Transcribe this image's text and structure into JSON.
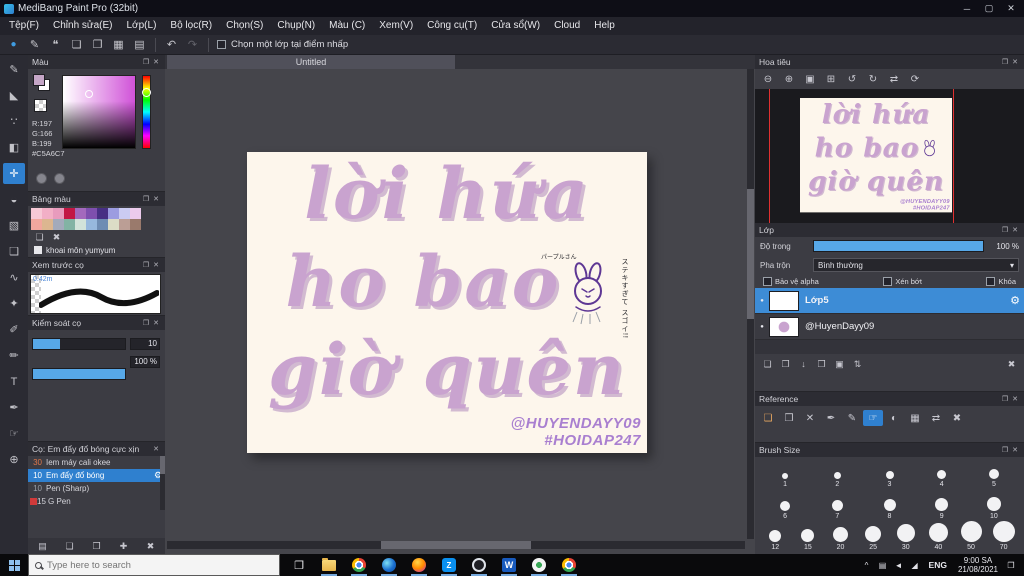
{
  "window": {
    "title": "MediBang Paint Pro (32bit)",
    "controls": [
      {
        "name": "minimize",
        "glyph": "─"
      },
      {
        "name": "maximize",
        "glyph": "▢"
      },
      {
        "name": "close",
        "glyph": "✕"
      }
    ]
  },
  "menubar": {
    "items": [
      "Tệp(F)",
      "Chỉnh sửa(E)",
      "Lớp(L)",
      "Bộ lọc(R)",
      "Chọn(S)",
      "Chụp(N)",
      "Màu (C)",
      "Xem(V)",
      "Công cụ(T)",
      "Cửa sổ(W)",
      "Cloud",
      "Help"
    ]
  },
  "toolbar": {
    "icons": [
      {
        "name": "brush-tip",
        "glyph": "●"
      },
      {
        "name": "pen",
        "glyph": "✎"
      },
      {
        "name": "comment",
        "glyph": "❝"
      },
      {
        "name": "page",
        "glyph": "❏"
      },
      {
        "name": "pages",
        "glyph": "❐"
      },
      {
        "name": "grid",
        "glyph": "▦"
      },
      {
        "name": "list",
        "glyph": "▤"
      }
    ],
    "undo": "↶",
    "redo": "↷",
    "select_layer_label": "Chọn một lớp tại điểm nhấp"
  },
  "toolstrip": {
    "tools": [
      {
        "name": "pen-tool",
        "glyph": "✎"
      },
      {
        "name": "eraser-tool",
        "glyph": "◣"
      },
      {
        "name": "smudge-tool",
        "glyph": "∵"
      },
      {
        "name": "fill-tool",
        "glyph": "◧"
      },
      {
        "name": "move-tool",
        "glyph": "✛"
      },
      {
        "name": "bucket-tool",
        "glyph": "◒"
      },
      {
        "name": "gradient-tool",
        "glyph": "▧"
      },
      {
        "name": "select-tool",
        "glyph": "❑"
      },
      {
        "name": "lasso-tool",
        "glyph": "∿"
      },
      {
        "name": "magic-wand-tool",
        "glyph": "✦"
      },
      {
        "name": "select-pen-tool",
        "glyph": "✐"
      },
      {
        "name": "select-eraser-tool",
        "glyph": "✏"
      },
      {
        "name": "text-tool",
        "glyph": "T"
      },
      {
        "name": "eyedropper-tool",
        "glyph": "✒"
      },
      {
        "name": "hand-tool",
        "glyph": "☞"
      },
      {
        "name": "zoom-tool",
        "glyph": "⊕"
      }
    ]
  },
  "document": {
    "tab": "Untitled"
  },
  "art": {
    "line1": "lời hứa",
    "line2": "ho bao",
    "line3": "giờ quên",
    "credit1": "@HUYENDAYY09",
    "credit2": "#HOIDAP247",
    "doodle_caption": "パープルさん",
    "doodle_side_text": "ステキすぎて スゴイ!!"
  },
  "colors": {
    "accent": "#2f80cf",
    "selection": "#3d8cd6",
    "paper": "#fdf6ec",
    "art_text": "#c9a3cf",
    "art_credit": "#a97fd0",
    "canvas_bg": "#45454b"
  },
  "color_panel": {
    "title": "Màu",
    "r": "R:197",
    "g": "G:166",
    "b": "B:199",
    "hex": "#C5A6C7",
    "current": "#C5A6C7"
  },
  "palette_panel": {
    "title": "Bảng màu",
    "tools": [
      {
        "name": "add-color",
        "glyph": "❏"
      },
      {
        "name": "delete-color",
        "glyph": "✖"
      }
    ],
    "item_label": "khoai môn yumyum",
    "row1": [
      "#f7c9d6",
      "#f2afc6",
      "#e89bbd",
      "#c21744",
      "#a369bd",
      "#7e4fae",
      "#472f84",
      "#9c9ce0",
      "#cbcbf2",
      "#eccbec"
    ],
    "row2": [
      "#f2a79e",
      "#dcb690",
      "#a3aabb",
      "#82b3a4",
      "#d2e3da",
      "#97b8dd",
      "#6e8cb3",
      "#dcdcc6",
      "#bb9e95",
      "#9a7a6c"
    ]
  },
  "preview_panel": {
    "title": "Xem trước cọ",
    "size_label": "0.42m"
  },
  "control_panel": {
    "title": "Kiểm soát cọ",
    "size_value": "10",
    "opacity_value": "100 %"
  },
  "brush_panel": {
    "title": "Cọ: Em đẩy đổ bóng cực xịn",
    "brushes": [
      {
        "size": "30",
        "name": "Iem máy cali okee",
        "num_color": "#e0784a"
      },
      {
        "size": "10",
        "name": "Em đẩy đổ bóng"
      },
      {
        "size": "10",
        "name": "Pen (Sharp)"
      },
      {
        "size": "15",
        "name": "G Pen",
        "chip": "#d03a3a"
      }
    ],
    "footer": [
      {
        "name": "brush-menu",
        "glyph": "▤"
      },
      {
        "name": "add-brush",
        "glyph": "❏"
      },
      {
        "name": "brush-folder",
        "glyph": "❒"
      },
      {
        "name": "new-brush",
        "glyph": "✚"
      },
      {
        "name": "delete-brush",
        "glyph": "✖"
      }
    ]
  },
  "nav_panel": {
    "title": "Hoa tiêu",
    "tools": [
      {
        "name": "zoom-out",
        "glyph": "⊖"
      },
      {
        "name": "zoom-in",
        "glyph": "⊕"
      },
      {
        "name": "fit-view",
        "glyph": "▣"
      },
      {
        "name": "pixel-view",
        "glyph": "⊞"
      },
      {
        "name": "rotate-left",
        "glyph": "↺"
      },
      {
        "name": "rotate-right",
        "glyph": "↻"
      },
      {
        "name": "flip-view",
        "glyph": "⇄"
      },
      {
        "name": "reset-view",
        "glyph": "⟳"
      }
    ]
  },
  "layer_panel": {
    "title": "Lớp",
    "opacity_label": "Độ trong",
    "opacity_value": "100 %",
    "blend_label": "Pha trộn",
    "blend_value": "Bình thường",
    "alpha_label": "Bảo vệ alpha",
    "clip_label": "Xén bớt",
    "lock_label": "Khóa",
    "layers": [
      {
        "name": "Lớp5"
      },
      {
        "name": "@HuyenDayy09"
      }
    ],
    "footer": [
      {
        "name": "add-layer",
        "glyph": "❏"
      },
      {
        "name": "duplicate-layer",
        "glyph": "❐"
      },
      {
        "name": "merge-down",
        "glyph": "↓"
      },
      {
        "name": "layer-folder",
        "glyph": "❒"
      },
      {
        "name": "flatten",
        "glyph": "▣"
      },
      {
        "name": "reorder",
        "glyph": "⇅"
      },
      {
        "name": "delete-layer",
        "glyph": "✖"
      }
    ]
  },
  "reference_panel": {
    "title": "Reference",
    "tools": [
      {
        "name": "open-image",
        "glyph": "❏"
      },
      {
        "name": "open-folder",
        "glyph": "❒"
      },
      {
        "name": "close-image",
        "glyph": "✕"
      },
      {
        "name": "eyedropper",
        "glyph": "✒"
      },
      {
        "name": "draw",
        "glyph": "✎"
      },
      {
        "name": "pan-hand",
        "glyph": "☞"
      },
      {
        "name": "invert",
        "glyph": "◐"
      },
      {
        "name": "grid",
        "glyph": "▦"
      },
      {
        "name": "flip",
        "glyph": "⇄"
      },
      {
        "name": "clear",
        "glyph": "✖"
      }
    ]
  },
  "brush_size_panel": {
    "title": "Brush Size",
    "row1": [
      "1",
      "2",
      "3",
      "4",
      "5"
    ],
    "row2": [
      "6",
      "7",
      "8",
      "9",
      "10"
    ],
    "row3": [
      "12",
      "15",
      "20",
      "25",
      "30",
      "40",
      "50",
      "70"
    ]
  },
  "taskbar": {
    "search_placeholder": "Type here to search",
    "apps": [
      {
        "name": "task-view"
      },
      {
        "name": "file-explorer"
      },
      {
        "name": "chrome"
      },
      {
        "name": "edge"
      },
      {
        "name": "firefox"
      },
      {
        "name": "zalo",
        "letter": "Z"
      },
      {
        "name": "dark-app"
      },
      {
        "name": "word",
        "letter": "W"
      },
      {
        "name": "coccoc"
      },
      {
        "name": "chrome-profile"
      }
    ],
    "tray": [
      {
        "name": "hidden-icons",
        "glyph": "^"
      },
      {
        "name": "display",
        "glyph": "▤"
      },
      {
        "name": "volume",
        "glyph": "◄"
      },
      {
        "name": "network",
        "glyph": "◢"
      }
    ],
    "lang": "ENG",
    "time": "9:00 SA",
    "date": "21/08/2021",
    "action_center_glyph": "❐"
  },
  "icons": {
    "panel_float": "❐",
    "panel_close": "✕",
    "caret": "▾",
    "gear": "⚙",
    "eye": "●",
    "task_view": "❐"
  }
}
